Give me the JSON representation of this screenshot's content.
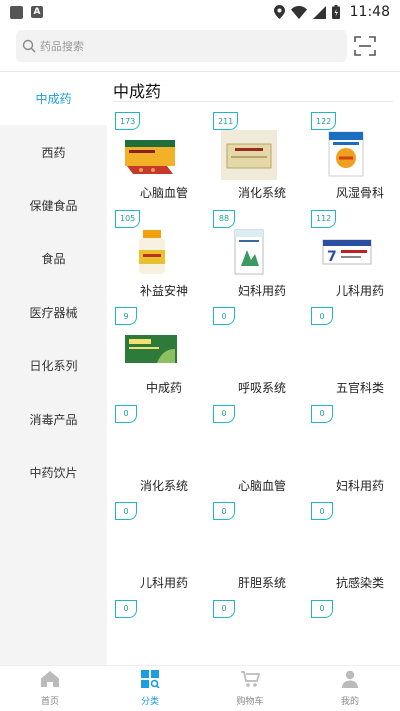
{
  "status_bar": {
    "time": "11:48"
  },
  "search": {
    "placeholder": "药品搜索"
  },
  "sidebar": {
    "items": [
      {
        "label": "中成药",
        "active": true
      },
      {
        "label": "西药",
        "active": false
      },
      {
        "label": "保健食品",
        "active": false
      },
      {
        "label": "食品",
        "active": false
      },
      {
        "label": "医疗器械",
        "active": false
      },
      {
        "label": "日化系列",
        "active": false
      },
      {
        "label": "消毒产品",
        "active": false
      },
      {
        "label": "中药饮片",
        "active": false
      }
    ]
  },
  "content": {
    "title": "中成药",
    "items": [
      {
        "label": "心脑血管",
        "count": "173",
        "image": "product-box-red"
      },
      {
        "label": "消化系统",
        "count": "211",
        "image": "product-box-beige"
      },
      {
        "label": "风湿骨科",
        "count": "122",
        "image": "product-box-blue"
      },
      {
        "label": "补益安神",
        "count": "105",
        "image": "product-bottle"
      },
      {
        "label": "妇科用药",
        "count": "88",
        "image": "product-box-green-white"
      },
      {
        "label": "儿科用药",
        "count": "112",
        "image": "product-box-blue-red"
      },
      {
        "label": "中成药",
        "count": "9",
        "image": "product-box-green"
      },
      {
        "label": "呼吸系统",
        "count": "0",
        "image": ""
      },
      {
        "label": "五官科类",
        "count": "0",
        "image": ""
      },
      {
        "label": "消化系统",
        "count": "0",
        "image": ""
      },
      {
        "label": "心脑血管",
        "count": "0",
        "image": ""
      },
      {
        "label": "妇科用药",
        "count": "0",
        "image": ""
      },
      {
        "label": "儿科用药",
        "count": "0",
        "image": ""
      },
      {
        "label": "肝胆系统",
        "count": "0",
        "image": ""
      },
      {
        "label": "抗感染类",
        "count": "0",
        "image": ""
      },
      {
        "label": "",
        "count": "0",
        "image": ""
      },
      {
        "label": "",
        "count": "0",
        "image": ""
      },
      {
        "label": "",
        "count": "0",
        "image": ""
      }
    ]
  },
  "bottom_nav": {
    "items": [
      {
        "label": "首页",
        "icon": "home-icon",
        "active": false
      },
      {
        "label": "分类",
        "icon": "category-icon",
        "active": true
      },
      {
        "label": "购物车",
        "icon": "cart-icon",
        "active": false
      },
      {
        "label": "我的",
        "icon": "user-icon",
        "active": false
      }
    ]
  },
  "colors": {
    "accent": "#1a9ee0",
    "badge_border": "#22b5c8",
    "sidebar_bg": "#f4f4f4"
  }
}
